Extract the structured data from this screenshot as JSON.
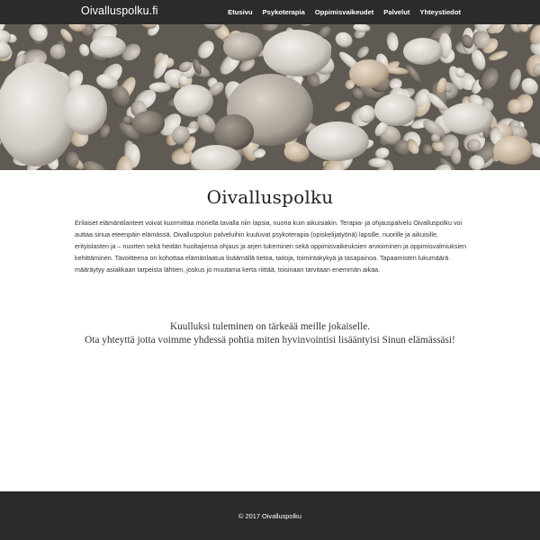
{
  "navbar": {
    "brand": "Oivalluspolku.fi",
    "links": [
      "Etusivu",
      "Psykoterapia",
      "Oppimisvaikeudet",
      "Palvelut",
      "Yhteystiedot"
    ]
  },
  "hero": {
    "image": "beach-pebbles-photo"
  },
  "main": {
    "title": "Oivalluspolku",
    "intro": "Erilaiset elämäntilanteet voivat kuormittaa monella tavalla niin lapsia, nuoria kuin aikuisiakin. Terapia- ja ohjauspalvelu Oivalluspolku voi auttaa sinua eteenpäin elämässä. Oivalluspolun palveluihin kuuluvat psykoterapia (opiskelijatyönä) lapsille, nuorille ja aikuisille, erityislasten ja – nuorten sekä heidän huoltajiensa ohjaus ja arjen tukeminen sekä oppimisvaikeuksien arvioiminen ja oppimisvalmiuksien kehittäminen. Tavoitteena on kohottaa elämänlaatua lisäämällä tietoa, taitoja, toimintakykyä ja tasapainoa. Tapaamisten lukumäärä määräytyy asiakkaan tarpeista lähtien, joskus jo muutama kerta riittää, toisinaan tarvitaan enemmän aikaa.",
    "tagline_1": "Kuulluksi tuleminen on tärkeää meille jokaiselle.",
    "tagline_2": "Ota yhteyttä jotta voimme yhdessä pohtia miten hyvinvointisi lisääntyisi Sinun elämässäsi!"
  },
  "footer": {
    "copyright": "© 2017 Oivalluspolku"
  },
  "colors": {
    "navbar_bg": "#2b2b2b",
    "footer_bg": "#2b2b2b",
    "page_bg": "#ffffff",
    "text": "#333333"
  }
}
